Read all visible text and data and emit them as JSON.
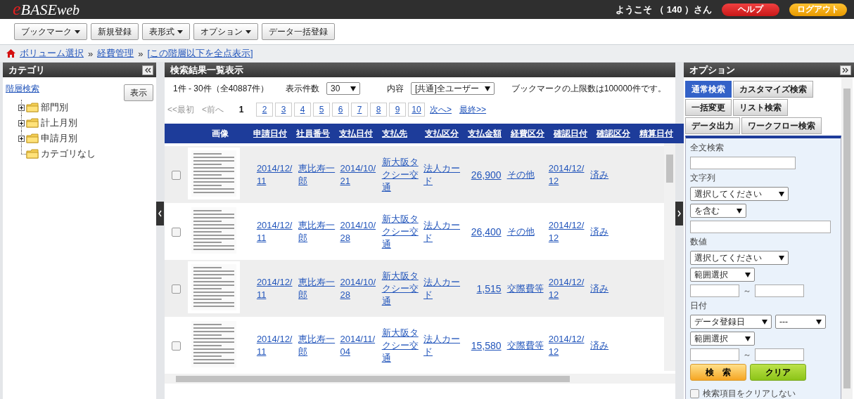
{
  "header": {
    "logo": {
      "prefix": "e",
      "main": "BASE",
      "suffix": "web"
    },
    "welcome": "ようこそ （ 140 ）さん",
    "buttons": [
      {
        "label": "ヘルプ",
        "kind": "help"
      },
      {
        "label": "ログアウト",
        "kind": "logout"
      }
    ]
  },
  "toolbar": [
    {
      "label": "ブックマーク",
      "dropdown": true
    },
    {
      "label": "新規登録",
      "dropdown": false
    },
    {
      "label": "表形式",
      "dropdown": true
    },
    {
      "label": "オプション",
      "dropdown": true
    },
    {
      "label": "データ一括登録",
      "dropdown": false
    }
  ],
  "breadcrumb": {
    "separator": "»",
    "items": [
      "ボリューム選択",
      "経費管理",
      "[この階層以下を全点表示]"
    ]
  },
  "category_panel": {
    "title": "カテゴリ",
    "search_link": "階層検索",
    "show_button": "表示",
    "tree": [
      {
        "label": "部門別",
        "has_children": true,
        "expanded": false
      },
      {
        "label": "計上月別",
        "has_children": true,
        "expanded": false
      },
      {
        "label": "申請月別",
        "has_children": true,
        "expanded": false
      },
      {
        "label": "カテゴリなし",
        "has_children": false
      }
    ]
  },
  "results_panel": {
    "title": "検索結果一覧表示",
    "summary": "1件 - 30件（全40887件）",
    "count_label": "表示件数",
    "count_value": "30",
    "content_label": "内容",
    "content_value": "[共通]全ユーザー",
    "note": "ブックマークの上限数は100000件です。",
    "pager": {
      "first": {
        "label": "<<最初",
        "disabled": true
      },
      "prev": {
        "label": "<前へ",
        "disabled": true
      },
      "pages": [
        {
          "label": "1",
          "selected": true
        },
        {
          "label": "2",
          "selected": false
        },
        {
          "label": "3",
          "selected": false
        },
        {
          "label": "4",
          "selected": false
        },
        {
          "label": "5",
          "selected": false
        },
        {
          "label": "6",
          "selected": false
        },
        {
          "label": "7",
          "selected": false
        },
        {
          "label": "8",
          "selected": false
        },
        {
          "label": "9",
          "selected": false
        },
        {
          "label": "10",
          "selected": false
        }
      ],
      "next": {
        "label": "次へ>",
        "disabled": false
      },
      "last": {
        "label": "最終>>",
        "disabled": false
      }
    },
    "table": {
      "columns": [
        "画像",
        "申請日付",
        "社員番号",
        "支払日付",
        "支払先",
        "支払区分",
        "支払金額",
        "経費区分",
        "確認日付",
        "確認区分",
        "精算日付"
      ],
      "rows": [
        {
          "checked": false,
          "cells": [
            {
              "kind": "picture"
            },
            "2014/12/11",
            "恵比寿一郎",
            "2014/10/21",
            "新大阪タクシー交通",
            "法人カード",
            "26,900",
            "その他",
            "2014/12/12",
            "済み",
            ""
          ]
        },
        {
          "checked": false,
          "cells": [
            {
              "kind": "picture"
            },
            "2014/12/11",
            "恵比寿一郎",
            "2014/10/28",
            "新大阪タクシー交通",
            "法人カード",
            "26,400",
            "その他",
            "2014/12/12",
            "済み",
            ""
          ]
        },
        {
          "checked": false,
          "cells": [
            {
              "kind": "picture"
            },
            "2014/12/11",
            "恵比寿一郎",
            "2014/10/28",
            "新大阪タクシー交通",
            "法人カード",
            "1,515",
            "交際費等",
            "2014/12/12",
            "済み",
            ""
          ]
        },
        {
          "checked": false,
          "cells": [
            {
              "kind": "picture"
            },
            "2014/12/11",
            "恵比寿一郎",
            "2014/11/04",
            "新大阪タクシー交通",
            "法人カード",
            "15,580",
            "交際費等",
            "2014/12/12",
            "済み",
            ""
          ]
        }
      ]
    }
  },
  "options_panel": {
    "title": "オプション",
    "tab_rows": [
      [
        {
          "label": "通常検索",
          "selected": true
        },
        {
          "label": "カスタマイズ検索",
          "selected": false
        }
      ],
      [
        {
          "label": "一括変更",
          "selected": false
        },
        {
          "label": "リスト検索",
          "selected": false
        }
      ],
      [
        {
          "label": "データ出力",
          "selected": false
        },
        {
          "label": "ワークフロー検索",
          "selected": false
        }
      ]
    ],
    "form": [
      {
        "kind": "label",
        "text": "全文検索"
      },
      {
        "kind": "input"
      },
      {
        "kind": "label",
        "text": "文字列"
      },
      {
        "kind": "select",
        "value": "選択してください"
      },
      {
        "kind": "select",
        "value": "を含む"
      },
      {
        "kind": "wide_input"
      },
      {
        "kind": "label",
        "text": "数値"
      },
      {
        "kind": "select",
        "value": "選択してください"
      },
      {
        "kind": "select",
        "value": "範囲選択"
      },
      {
        "kind": "range",
        "separator": "～"
      },
      {
        "kind": "label",
        "text": "日付"
      },
      {
        "kind": "select_pair",
        "values": [
          "データ登録日",
          "---"
        ]
      },
      {
        "kind": "select",
        "value": "範囲選択"
      },
      {
        "kind": "range",
        "separator": "～"
      },
      {
        "kind": "buttons",
        "search": "検　索",
        "clear": "クリア"
      },
      {
        "kind": "checkbox",
        "label": "検索項目をクリアしない",
        "checked": false
      }
    ]
  }
}
